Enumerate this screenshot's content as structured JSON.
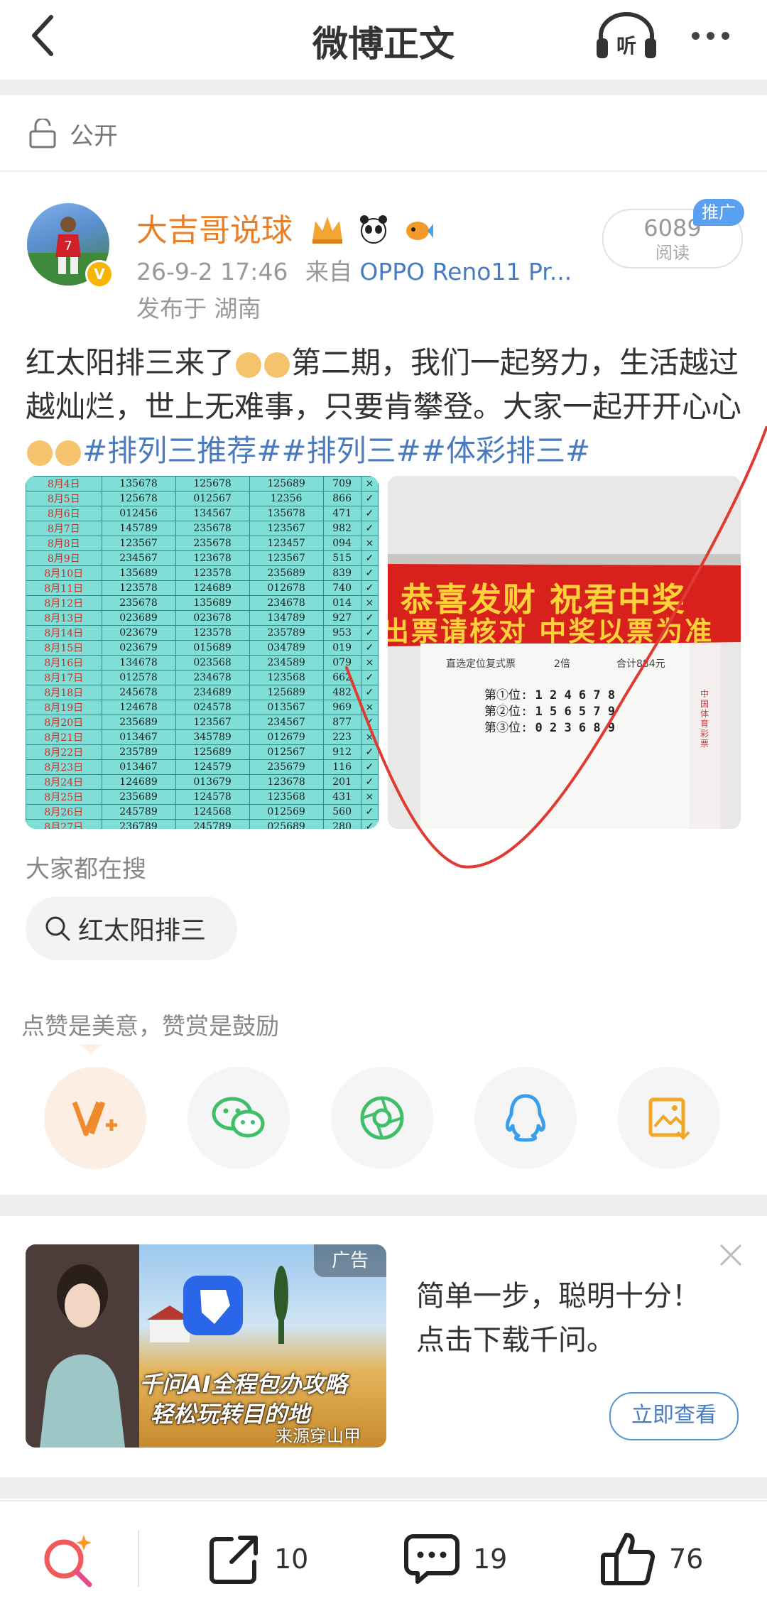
{
  "header": {
    "title": "微博正文"
  },
  "visibility": {
    "label": "公开"
  },
  "author": {
    "name": "大吉哥说球",
    "time": "26-9-2 17:46",
    "from_label": "来自",
    "source": "OPPO Reno11 Pr...",
    "location": "发布于 湖南",
    "read_count": "6089",
    "read_label": "阅读",
    "promo_tag": "推广"
  },
  "post": {
    "text_1": "红太阳排三来了",
    "text_2": "第二期，我们一起努力，生活越过越灿烂，世上无难事，只要肯攀登。大家一起开开心心",
    "hashtags": [
      "#排列三推荐#",
      "#排列三#",
      "#体彩排三#"
    ]
  },
  "lottery_table": [
    [
      "8月4日",
      "135678",
      "125678",
      "125689",
      "709",
      "×"
    ],
    [
      "8月5日",
      "125678",
      "012567",
      "12356",
      "866",
      "✓"
    ],
    [
      "8月6日",
      "012456",
      "134567",
      "135678",
      "471",
      "✓"
    ],
    [
      "8月7日",
      "145789",
      "235678",
      "123567",
      "982",
      "✓"
    ],
    [
      "8月8日",
      "123567",
      "235678",
      "123457",
      "094",
      "×"
    ],
    [
      "8月9日",
      "234567",
      "123678",
      "123567",
      "515",
      "✓"
    ],
    [
      "8月10日",
      "135689",
      "123578",
      "235689",
      "839",
      "✓"
    ],
    [
      "8月11日",
      "123578",
      "124689",
      "012678",
      "740",
      "✓"
    ],
    [
      "8月12日",
      "235678",
      "135689",
      "234678",
      "014",
      "×"
    ],
    [
      "8月13日",
      "023689",
      "023678",
      "134789",
      "927",
      "✓"
    ],
    [
      "8月14日",
      "023679",
      "123578",
      "235789",
      "953",
      "✓"
    ],
    [
      "8月15日",
      "023679",
      "015689",
      "034789",
      "019",
      "✓"
    ],
    [
      "8月16日",
      "134678",
      "023568",
      "234589",
      "079",
      "×"
    ],
    [
      "8月17日",
      "012578",
      "234678",
      "123568",
      "662",
      "✓"
    ],
    [
      "8月18日",
      "245678",
      "234689",
      "125689",
      "482",
      "✓"
    ],
    [
      "8月19日",
      "124678",
      "024578",
      "013567",
      "969",
      "×"
    ],
    [
      "8月20日",
      "235689",
      "123567",
      "234567",
      "877",
      "✓"
    ],
    [
      "8月21日",
      "013467",
      "345789",
      "012679",
      "223",
      "×"
    ],
    [
      "8月22日",
      "235789",
      "125689",
      "012567",
      "912",
      "✓"
    ],
    [
      "8月23日",
      "013467",
      "124579",
      "235679",
      "116",
      "✓"
    ],
    [
      "8月24日",
      "124689",
      "013679",
      "123678",
      "201",
      "✓"
    ],
    [
      "8月25日",
      "235689",
      "124578",
      "123568",
      "431",
      "×"
    ],
    [
      "8月26日",
      "245789",
      "124568",
      "012569",
      "560",
      "✓"
    ],
    [
      "8月27日",
      "236789",
      "245789",
      "025689",
      "280",
      "✓"
    ]
  ],
  "ticket": {
    "banner_line1": "恭喜发财 祝君中奖",
    "banner_line2": "出票请核对 中奖以票为准",
    "ticket_type": "直选定位复式票",
    "multiplier": "2倍",
    "total": "合计884元",
    "pos1_label": "第①位:",
    "pos1": "1 2 4 6 7 8",
    "pos2_label": "第②位:",
    "pos2": "1 5 6 5 7 9",
    "pos3_label": "第③位:",
    "pos3": "0 2 3 6 8 9",
    "side_text": "中国体育彩票"
  },
  "search": {
    "heading": "大家都在搜",
    "chip": "红太阳排三"
  },
  "share": {
    "tip": "点赞是美意，赞赏是鼓励",
    "icons": [
      "reward-icon",
      "wechat-icon",
      "moments-icon",
      "qq-icon",
      "save-image-icon"
    ]
  },
  "ad": {
    "tag": "广告",
    "title_line1": "简单一步，聪明十分！",
    "title_line2": "点击下载千问。",
    "caption1": "千问AI全程包办攻略",
    "caption2": "轻松玩转目的地",
    "credit": "来源穿山甲",
    "button": "立即查看"
  },
  "bottom": {
    "repost_count": "10",
    "comment_count": "19",
    "like_count": "76"
  },
  "colors": {
    "accent_orange": "#e8802a",
    "link_blue": "#4a7bbf",
    "table_bg": "#7fded5",
    "banner_red": "#d8201c"
  }
}
